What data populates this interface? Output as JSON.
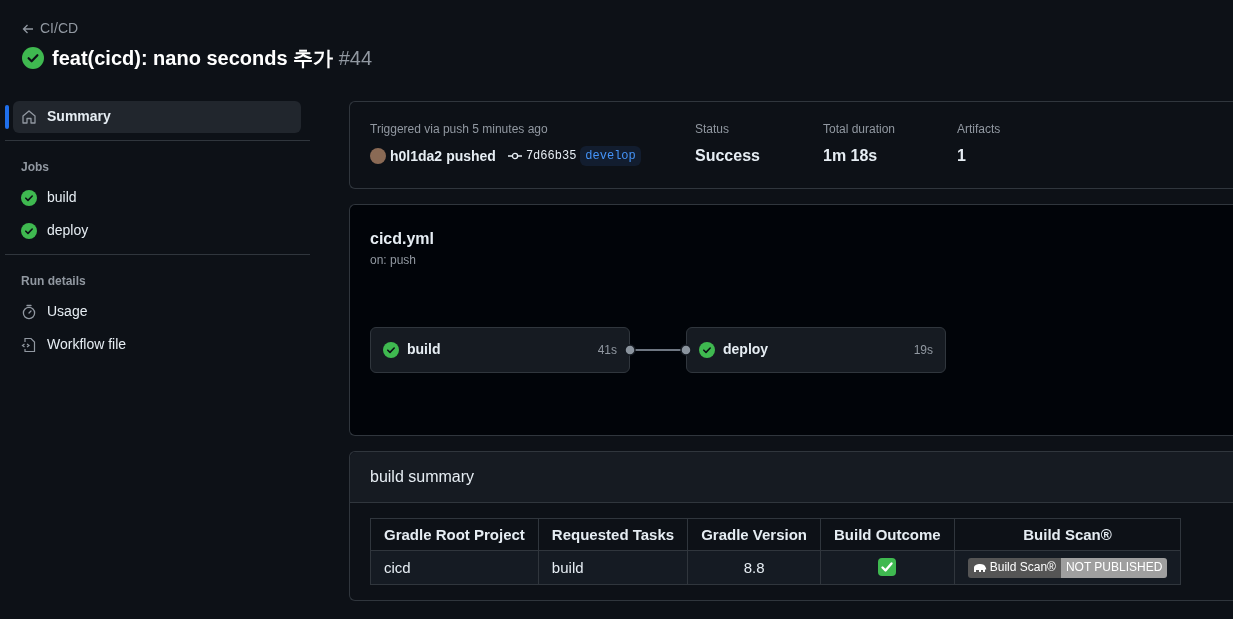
{
  "breadcrumb": "CI/CD",
  "run": {
    "title": "feat(cicd): nano seconds 추가",
    "number": "#44",
    "succeeded": true
  },
  "sidebar": {
    "sections": [
      {
        "items": [
          {
            "label": "Summary",
            "kind": "home",
            "selected": true
          }
        ]
      },
      {
        "heading": "Jobs",
        "items": [
          {
            "label": "build",
            "kind": "success",
            "selected": false
          },
          {
            "label": "deploy",
            "kind": "success",
            "selected": false
          }
        ]
      },
      {
        "heading": "Run details",
        "items": [
          {
            "label": "Usage",
            "kind": "stopwatch",
            "selected": false
          },
          {
            "label": "Workflow file",
            "kind": "file",
            "selected": false
          }
        ]
      }
    ]
  },
  "summary": {
    "trigger": "Triggered via push 5 minutes ago",
    "actor": "h0l1da2",
    "action": "pushed",
    "commit": "7d66b35",
    "branch": "develop",
    "stats": [
      {
        "label": "Status",
        "value": "Success"
      },
      {
        "label": "Total duration",
        "value": "1m 18s"
      },
      {
        "label": "Artifacts",
        "value": "1"
      }
    ]
  },
  "workflow": {
    "name": "cicd.yml",
    "trigger": "on: push",
    "jobs": [
      {
        "name": "build",
        "duration": "41s",
        "succeeded": true
      },
      {
        "name": "deploy",
        "duration": "19s",
        "succeeded": true
      }
    ]
  },
  "build_summary": {
    "title": "build summary",
    "table": {
      "columns": [
        "Gradle Root Project",
        "Requested Tasks",
        "Gradle Version",
        "Build Outcome",
        "Build Scan®"
      ],
      "rows": [
        {
          "cells": [
            "cicd",
            "build",
            "8.8"
          ],
          "passed": true,
          "scan": {
            "label": "Build Scan®",
            "status": "NOT PUBLISHED"
          }
        }
      ]
    }
  }
}
